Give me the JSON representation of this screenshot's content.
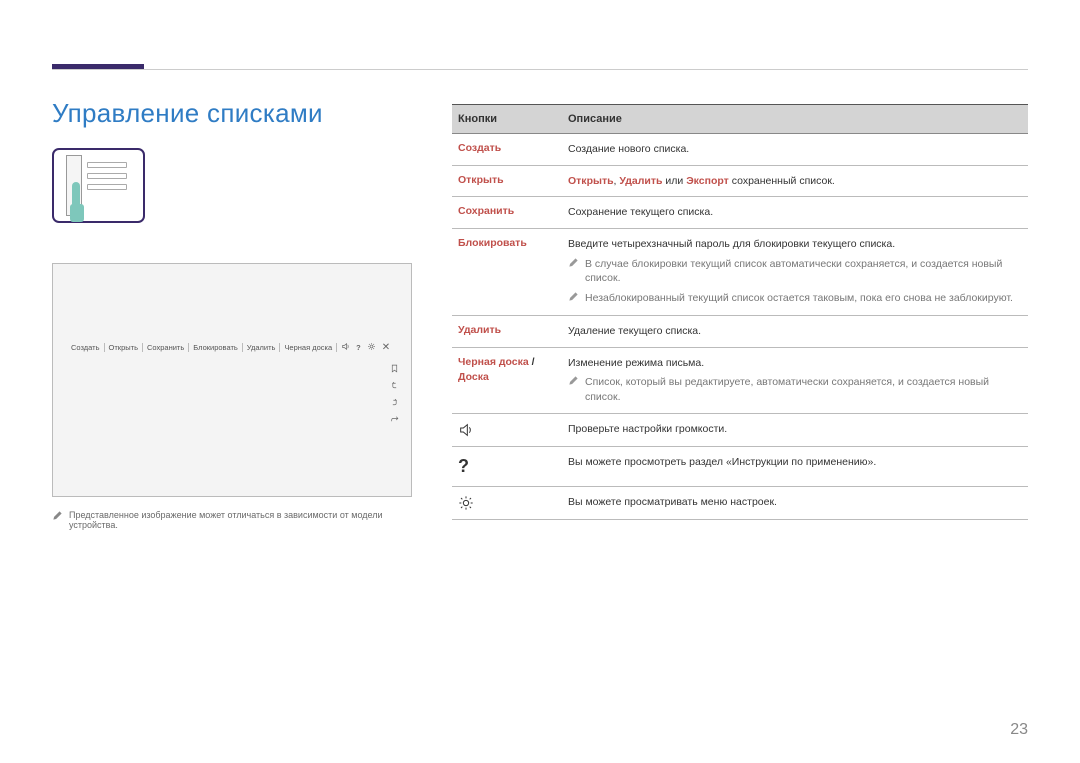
{
  "header": {
    "title": "Управление списками"
  },
  "gesture": {
    "label": "gesture-swipe-menu"
  },
  "screenshot": {
    "menubar_items": [
      "Создать",
      "Открыть",
      "Сохранить",
      "Блокировать",
      "Удалить",
      "Черная доска"
    ],
    "menubar_icons": [
      "volume-icon",
      "help-icon",
      "gear-icon",
      "close-icon"
    ],
    "side_icons": [
      "bookmark-icon",
      "undo-icon",
      "redo-arrow-icon",
      "share-icon"
    ]
  },
  "footnote": "Представленное изображение может отличаться в зависимости от модели устройства.",
  "table": {
    "header": {
      "col1": "Кнопки",
      "col2": "Описание"
    },
    "rows": {
      "create": {
        "label": "Создать",
        "desc": "Создание нового списка."
      },
      "open": {
        "label": "Открыть",
        "desc_parts": {
          "p1": "Открыть",
          "c1": ", ",
          "p2": "Удалить",
          "c2": " или ",
          "p3": "Экспорт",
          "c3": " сохраненный список."
        }
      },
      "save": {
        "label": "Сохранить",
        "desc": "Сохранение текущего списка."
      },
      "lock": {
        "label": "Блокировать",
        "desc": "Введите четырехзначный пароль для блокировки текущего списка.",
        "note1": "В случае блокировки текущий список автоматически сохраняется, и создается новый список.",
        "note2": "Незаблокированный текущий список остается таковым, пока его снова не заблокируют."
      },
      "delete": {
        "label": "Удалить",
        "desc": "Удаление текущего списка."
      },
      "board": {
        "label1": "Черная доска",
        "sep": " /",
        "label2": "Доска",
        "desc": "Изменение режима письма.",
        "note1": "Список, который вы редактируете, автоматически сохраняется, и создается новый список."
      },
      "volume": {
        "desc": "Проверьте настройки громкости."
      },
      "help": {
        "desc": "Вы можете просмотреть раздел «Инструкции по применению»."
      },
      "settings": {
        "desc": "Вы можете просматривать меню настроек."
      }
    }
  },
  "page_number": "23"
}
